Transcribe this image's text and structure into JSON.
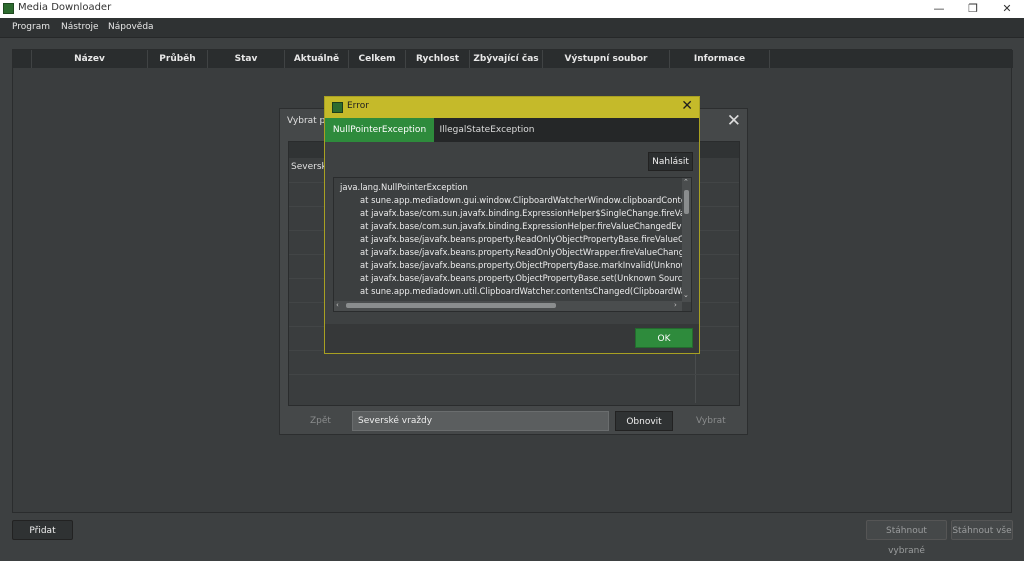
{
  "window": {
    "title": "Media Downloader",
    "controls": [
      "—",
      "❐",
      "✕"
    ]
  },
  "menu": [
    "Program",
    "Nástroje",
    "Nápověda"
  ],
  "table": {
    "columns": [
      "Název",
      "Průběh",
      "Stav",
      "Aktuálně",
      "Celkem",
      "Rychlost",
      "Zbývající čas",
      "Výstupní soubor",
      "Informace"
    ]
  },
  "bottom": {
    "add": "Přidat",
    "download_selected": "Stáhnout vybrané",
    "download_all": "Stáhnout vše"
  },
  "select_dialog": {
    "title": "Vybrat po",
    "close": "✕",
    "list_item": "Severské",
    "back": "Zpět",
    "input_value": "Severské vraždy",
    "refresh": "Obnovit",
    "select": "Vybrat"
  },
  "error_dialog": {
    "title": "Error",
    "close": "✕",
    "tabs": [
      {
        "label": "NullPointerException",
        "active": true
      },
      {
        "label": "IllegalStateException",
        "active": false
      }
    ],
    "report": "Nahlásit",
    "trace": [
      "java.lang.NullPointerException",
      "at sune.app.mediadown.gui.window.ClipboardWatcherWindow.clipboardContents",
      "at javafx.base/com.sun.javafx.binding.ExpressionHelper$SingleChange.fireValueCh",
      "at javafx.base/com.sun.javafx.binding.ExpressionHelper.fireValueChangedEvent(U",
      "at javafx.base/javafx.beans.property.ReadOnlyObjectPropertyBase.fireValueChang",
      "at javafx.base/javafx.beans.property.ReadOnlyObjectWrapper.fireValueChangedEv",
      "at javafx.base/javafx.beans.property.ObjectPropertyBase.markInvalid(Unknown So",
      "at javafx.base/javafx.beans.property.ObjectPropertyBase.set(Unknown Source)",
      "at sune.app.mediadown.util.ClipboardWatcher.contentsChanged(ClipboardWatch"
    ],
    "ok": "OK"
  },
  "colors": {
    "accent_green": "#2e8b3c",
    "error_titlebar": "#c5ba2a",
    "background": "#3d4041"
  }
}
